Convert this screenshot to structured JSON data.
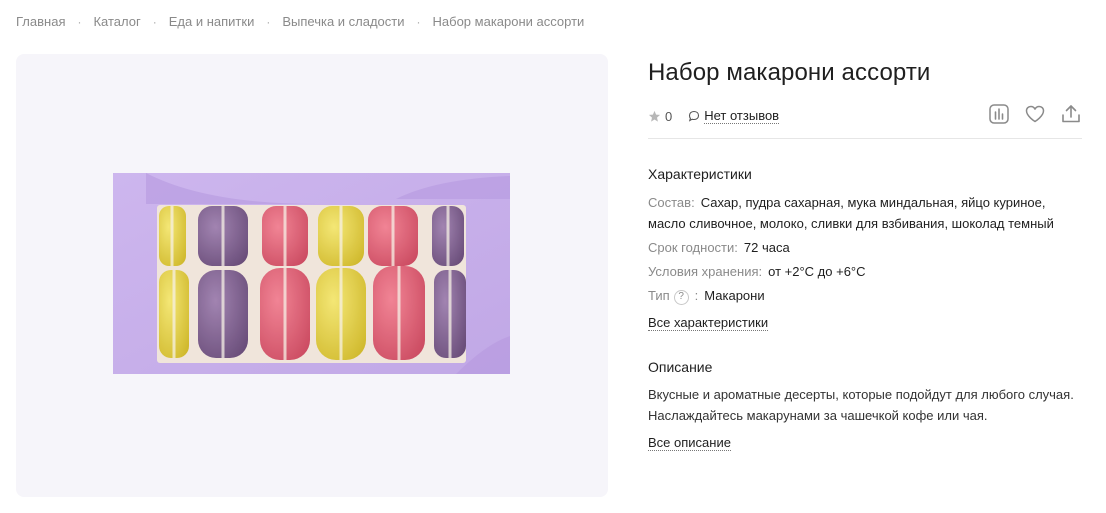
{
  "breadcrumb": [
    "Главная",
    "Каталог",
    "Еда и напитки",
    "Выпечка и сладости",
    "Набор макарони ассорти"
  ],
  "product": {
    "title": "Набор макарони ассорти",
    "rating": "0",
    "reviews_label": "Нет отзывов"
  },
  "specs": {
    "heading": "Характеристики",
    "items": [
      {
        "key": "Состав",
        "value": "Сахар, пудра сахарная, мука миндальная, яйцо куриное, масло сливочное, молоко, сливки для взбивания, шоколад темный"
      },
      {
        "key": "Срок годности",
        "value": "72 часа"
      },
      {
        "key": "Условия хранения",
        "value": "от +2°C до +6°C"
      },
      {
        "key": "Тип",
        "value": "Макарони",
        "help": "?"
      }
    ],
    "all_link": "Все характеристики"
  },
  "description": {
    "heading": "Описание",
    "text": "Вкусные и ароматные десерты, которые подойдут для любого случая. Наслаждайтесь макарунами за чашечкой кофе или чая.",
    "all_link": "Все описание"
  },
  "actions": {
    "compare_icon": "compare-chart-icon",
    "favorite_icon": "heart-icon",
    "share_icon": "share-icon"
  },
  "colors": {
    "box": "#c9b4ec",
    "yellow": "#e8d23a",
    "pink": "#e2566c",
    "purple": "#7e5a8e",
    "gallery_bg": "#f6f5fa"
  }
}
